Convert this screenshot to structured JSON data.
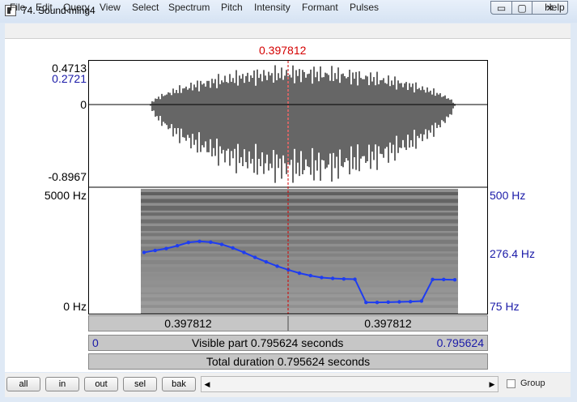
{
  "window": {
    "title": "74. Sound ming4",
    "min_symbol": "▭",
    "max_symbol": "▢",
    "close_symbol": "✕"
  },
  "menu": [
    "File",
    "Edit",
    "Query",
    "View",
    "Select",
    "Spectrum",
    "Pitch",
    "Intensity",
    "Formant",
    "Pulses",
    "Help"
  ],
  "cursor": {
    "time": "0.397812",
    "color": "#d40000"
  },
  "waveform": {
    "y_max": "0.4713",
    "y_cursor_value": "0.2721",
    "y_zero": "0",
    "y_min": "-0.8967"
  },
  "spectrogram": {
    "freq_top": "5000 Hz",
    "freq_bottom": "0 Hz"
  },
  "pitch": {
    "top": "500 Hz",
    "mid": "276.4 Hz",
    "bottom": "75 Hz",
    "color": "#1f3df0",
    "contour_hz": [
      276,
      283,
      290,
      300,
      312,
      316,
      313,
      305,
      292,
      276,
      258,
      242,
      226,
      213,
      201,
      192,
      185,
      182,
      180,
      179,
      95,
      95,
      96,
      97,
      98,
      100,
      178,
      178,
      177
    ]
  },
  "timebars": {
    "left_segment": "0.397812",
    "right_segment": "0.397812",
    "visible_start": "0",
    "visible_label": "Visible part 0.795624 seconds",
    "visible_end": "0.795624",
    "total_label": "Total duration 0.795624 seconds"
  },
  "bottom": {
    "buttons": [
      "all",
      "in",
      "out",
      "sel",
      "bak"
    ],
    "left_arrow": "◀",
    "right_arrow": "▶",
    "group_label": "Group"
  }
}
